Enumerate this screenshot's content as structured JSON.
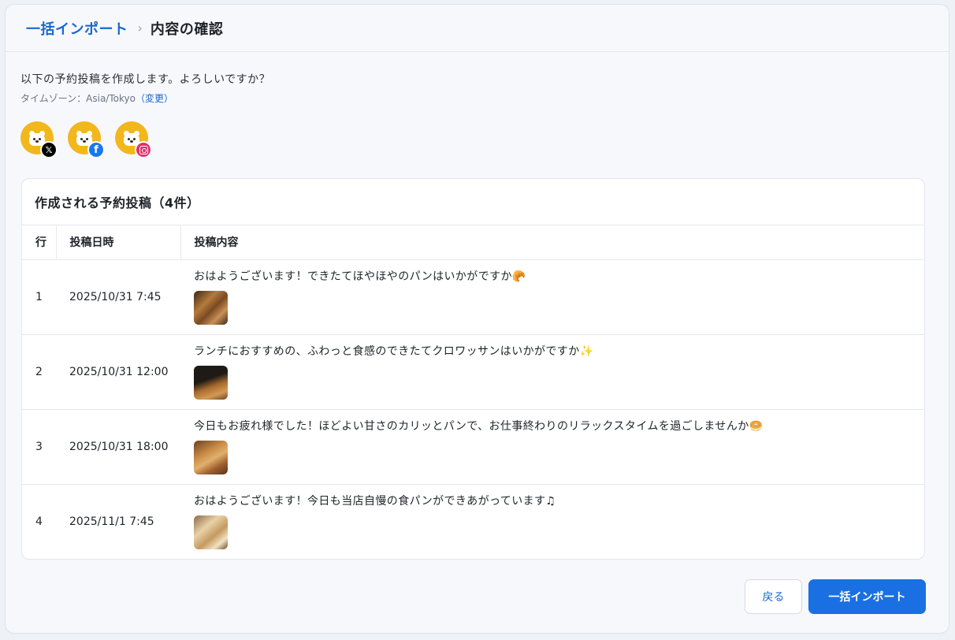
{
  "breadcrumb": {
    "parent": "一括インポート",
    "separator": "›",
    "current": "内容の確認"
  },
  "intro": {
    "question": "以下の予約投稿を作成します。よろしいですか？",
    "timezone_label": "タイムゾーン：Asia/Tokyo",
    "timezone_change_link": "（変更）"
  },
  "accounts": [
    {
      "network": "X",
      "badge": "𝕏",
      "icon": "x-logo-icon",
      "color": "#000000"
    },
    {
      "network": "Facebook",
      "badge": "f",
      "icon": "facebook-logo-icon",
      "color": "#1877f2"
    },
    {
      "network": "Instagram",
      "badge": "",
      "icon": "instagram-logo-icon",
      "color": "#e1306c"
    }
  ],
  "table": {
    "title": "作成される予約投稿（4件）",
    "columns": [
      "行",
      "投稿日時",
      "投稿内容"
    ],
    "rows": [
      {
        "row": "1",
        "datetime": "2025/10/31 7:45",
        "content": "おはようございます！できたてほやほやのパンはいかがですか🥐",
        "image": "bread-photo"
      },
      {
        "row": "2",
        "datetime": "2025/10/31 12:00",
        "content": "ランチにおすすめの、ふわっと食感のできたてクロワッサンはいかがですか✨",
        "image": "croissant-photo"
      },
      {
        "row": "3",
        "datetime": "2025/10/31 18:00",
        "content": "今日もお疲れ様でした！ほどよい甘さのカリッとパンで、お仕事終わりのリラックスタイムを過ごしませんか🥯",
        "image": "pastry-photo"
      },
      {
        "row": "4",
        "datetime": "2025/11/1 7:45",
        "content": "おはようございます！今日も当店自慢の食パンができあがっています♫",
        "image": "shokupan-photo"
      }
    ]
  },
  "actions": {
    "back_label": "戻る",
    "import_label": "一括インポート"
  },
  "colors": {
    "accent": "#1a6fe3",
    "link": "#1a67d2",
    "avatar": "#f2b71c"
  }
}
